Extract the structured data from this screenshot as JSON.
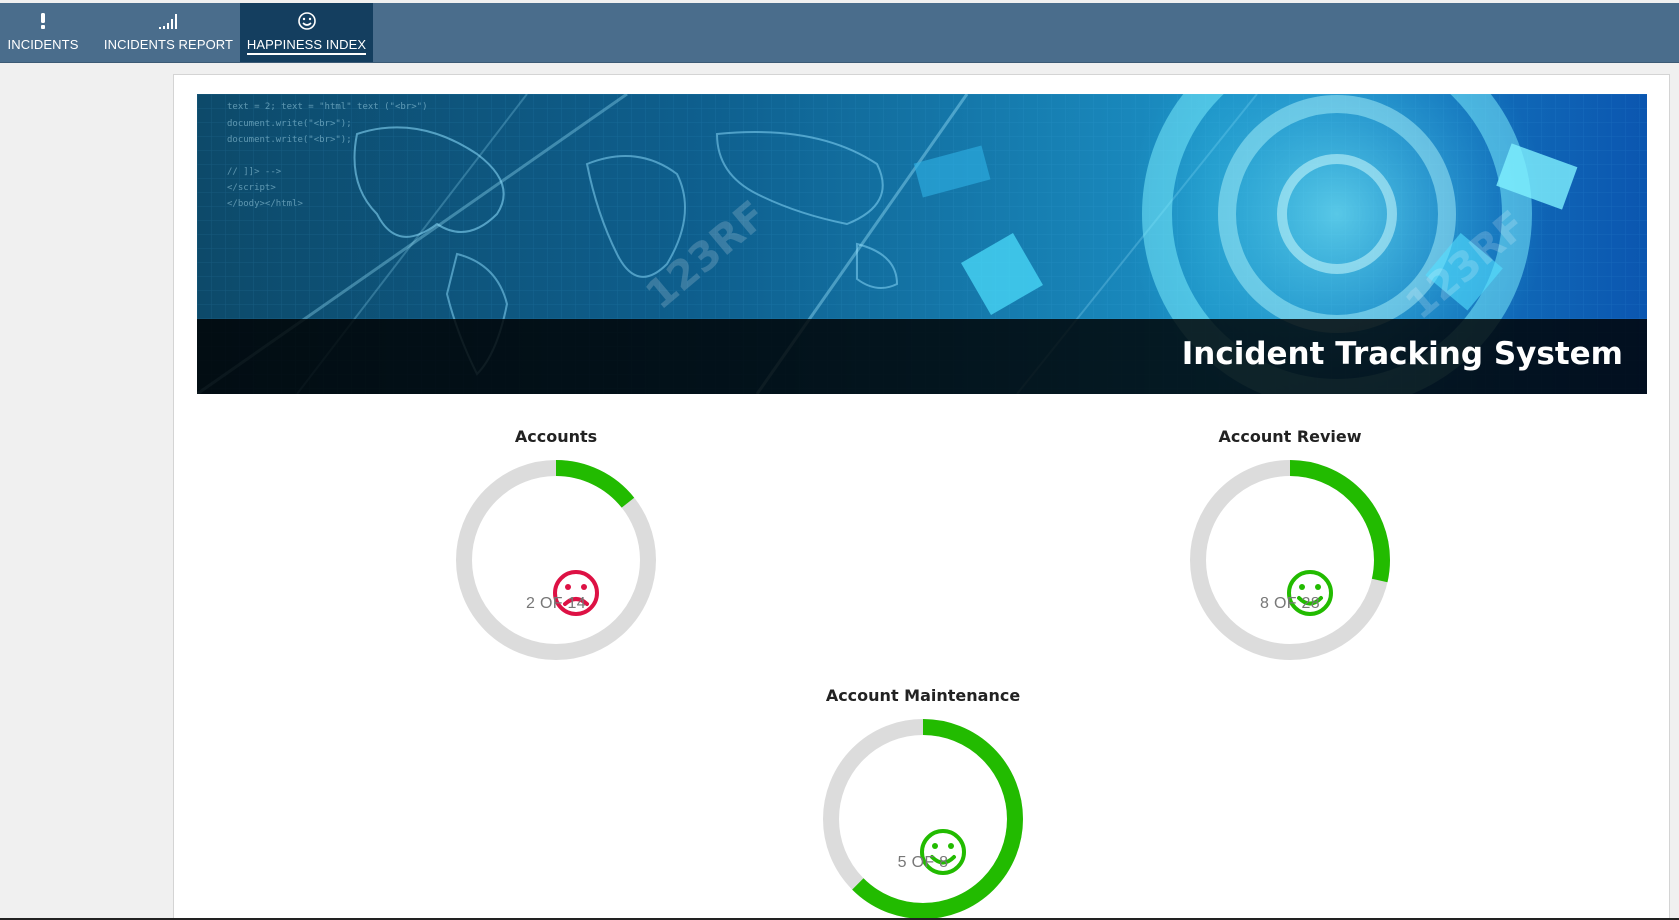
{
  "nav": {
    "tabs": [
      {
        "label": "INCIDENTS",
        "icon": "exclamation-icon",
        "active": false
      },
      {
        "label": "INCIDENTS REPORT",
        "icon": "signal-bars-icon",
        "active": false
      },
      {
        "label": "HAPPINESS INDEX",
        "icon": "smiley-icon",
        "active": true
      }
    ]
  },
  "banner": {
    "title": "Incident Tracking System",
    "watermark": "123RF"
  },
  "gauges": [
    {
      "title": "Accounts",
      "count": "2 OF 14",
      "fraction": 0.1429,
      "mood": "sad",
      "mood_icon": "sad-face-icon",
      "mood_color": "#dd1144"
    },
    {
      "title": "Account Review",
      "count": "8 OF 28",
      "fraction": 0.2857,
      "mood": "happy",
      "mood_icon": "happy-face-icon",
      "mood_color": "#22bb00"
    },
    {
      "title": "Account Maintenance",
      "count": "5 OF 8",
      "fraction": 0.625,
      "mood": "happy",
      "mood_icon": "happy-face-icon",
      "mood_color": "#22bb00"
    }
  ],
  "colors": {
    "nav_bg": "#4a6d8c",
    "nav_active": "#143e5f",
    "gauge_track": "#dcdcdc",
    "gauge_fill": "#22bb00"
  }
}
